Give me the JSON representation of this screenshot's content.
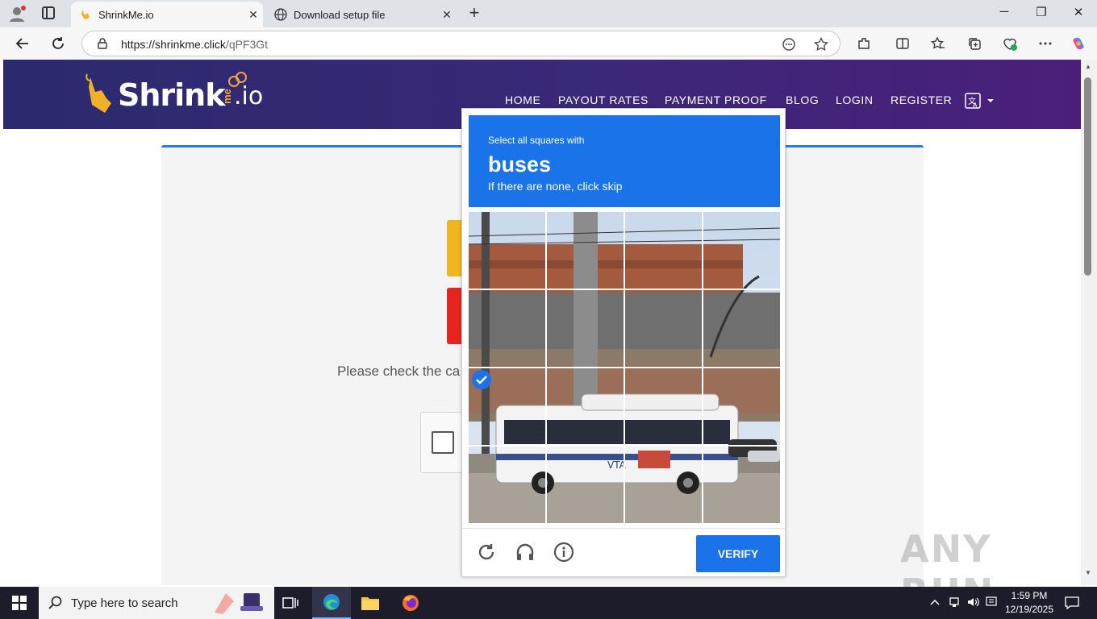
{
  "browser": {
    "tabs": [
      {
        "title": "ShrinkMe.io",
        "active": true
      },
      {
        "title": "Download setup file",
        "active": false
      }
    ],
    "url_host": "https://shrinkme.click",
    "url_path": "/qPF3Gt"
  },
  "site": {
    "logo_text": "Shrink",
    "logo_me": "me",
    "logo_io": ".io",
    "nav": [
      "HOME",
      "PAYOUT RATES",
      "PAYMENT PROOF",
      "BLOG",
      "LOGIN",
      "REGISTER"
    ],
    "please_text": "Please check the ca"
  },
  "captcha": {
    "instruction": "Select all squares with",
    "target": "buses",
    "hint": "If there are none, click skip",
    "verify_label": "VERIFY",
    "selected_tiles": [
      8
    ]
  },
  "watermark": "ANY RUN",
  "taskbar": {
    "search_placeholder": "Type here to search",
    "time": "1:59 PM",
    "date": "12/19/2025"
  },
  "colors": {
    "captcha_blue": "#1a73e8",
    "header_purple": "#3b2878",
    "card_accent": "#2c7be5"
  }
}
